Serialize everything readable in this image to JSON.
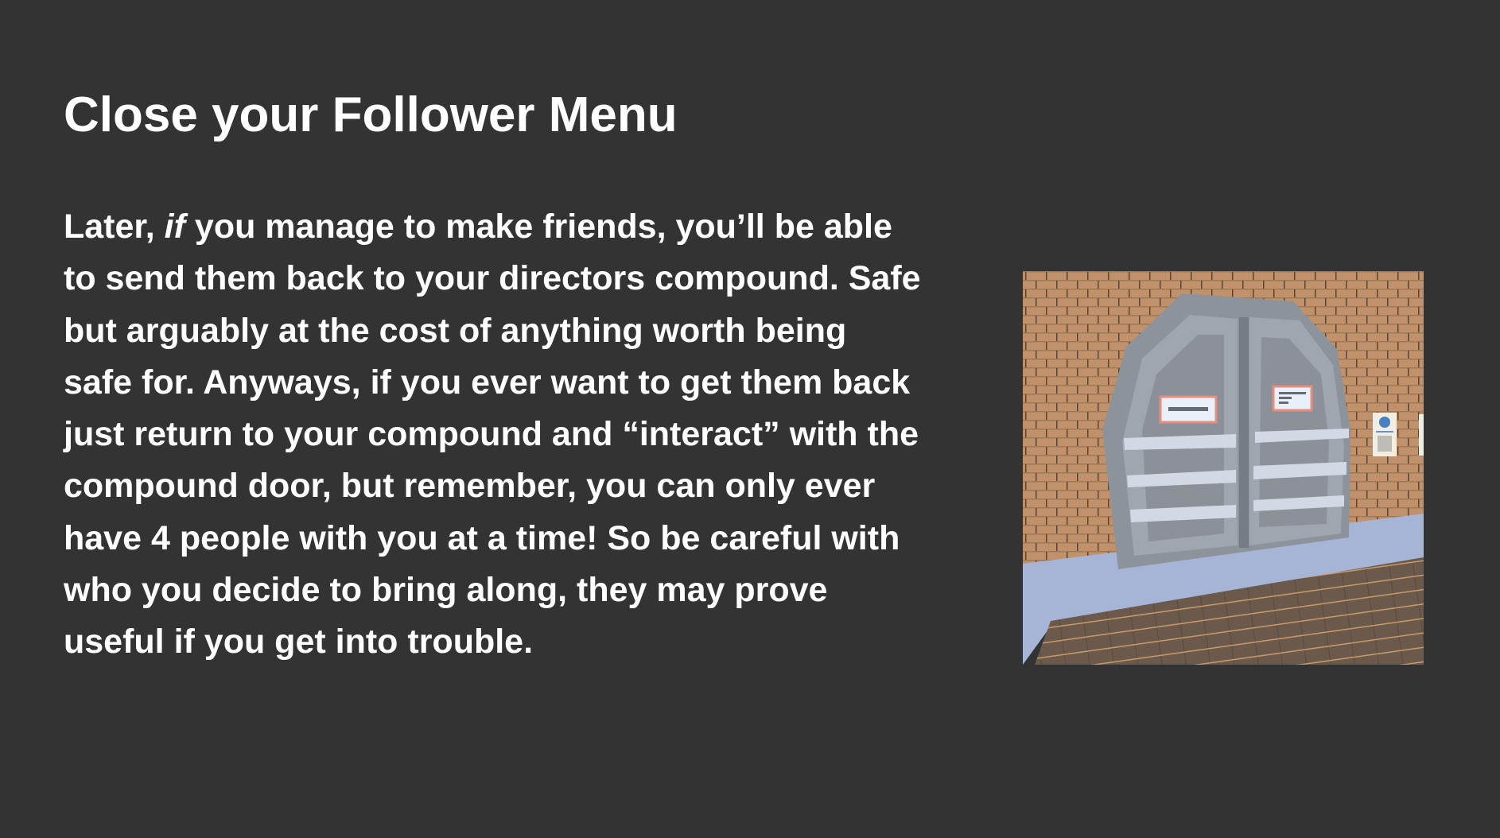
{
  "slide": {
    "title": "Close your Follower Menu",
    "body_lines": [
      {
        "pre": "Later, ",
        "em": "if",
        "post": " you manage to make friends, you’ll be able"
      },
      {
        "text": "to send them back to your directors compound. Safe"
      },
      {
        "text": "but arguably at the cost of anything worth being"
      },
      {
        "text": "safe for. Anyways, if you ever want to get them back"
      },
      {
        "text": "just return to your compound and “interact” with the"
      },
      {
        "text": "compound door, but remember, you can only ever"
      },
      {
        "text": "have 4 people with you at a time! So be careful with"
      },
      {
        "text": "who you decide to bring along, they may prove"
      },
      {
        "text": "useful if you get into trouble."
      }
    ]
  },
  "colors": {
    "background": "#333333",
    "text": "#ffffff",
    "brick": "#c0916a",
    "floor": "#6b5a4c",
    "walkway": "#a6b5d5",
    "door": "#8d939b"
  }
}
